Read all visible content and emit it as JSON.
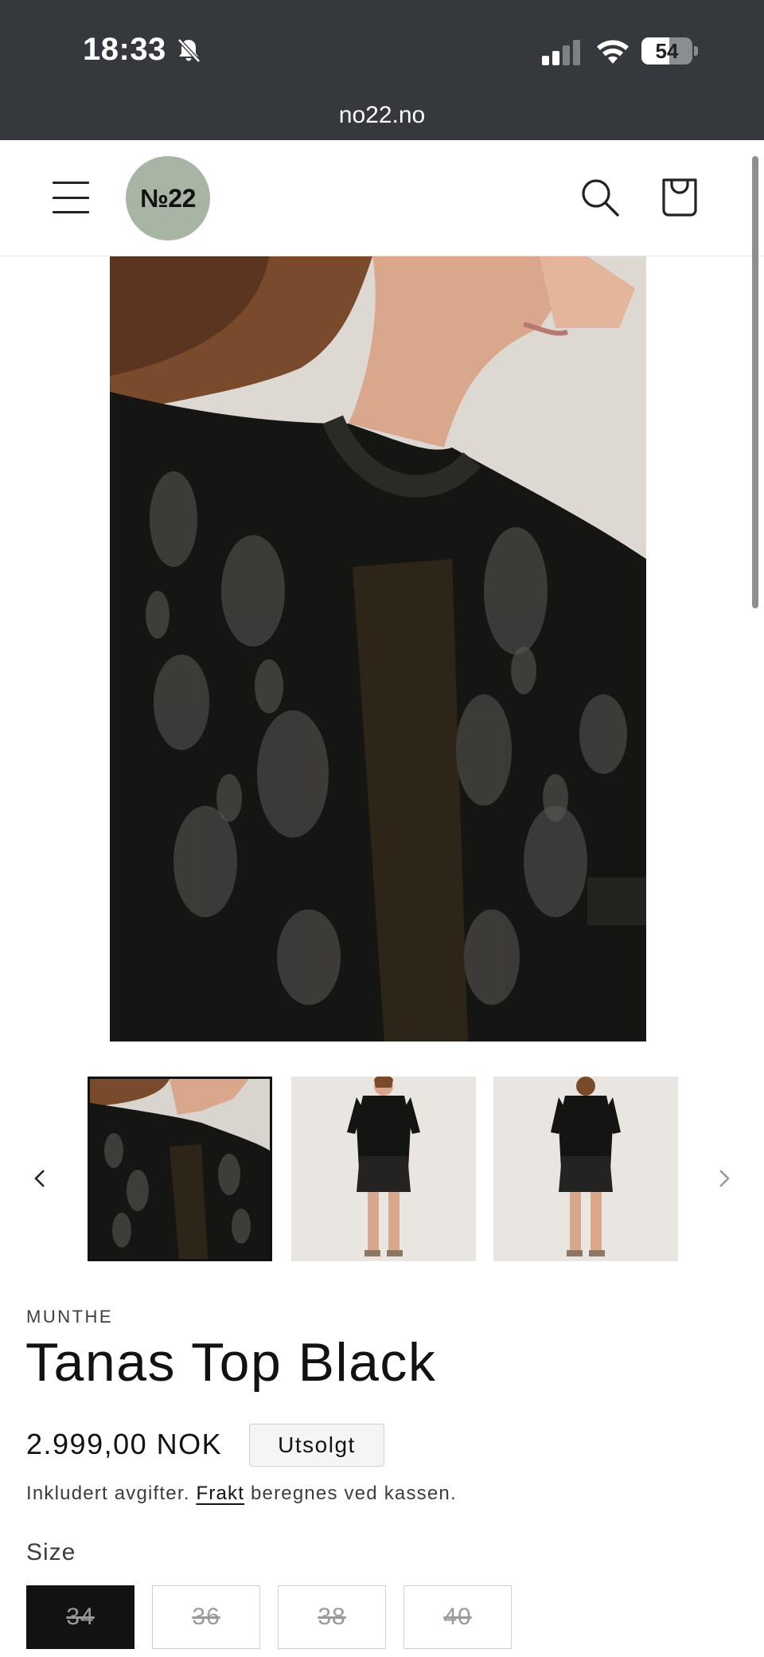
{
  "status_bar": {
    "time": "18:33",
    "battery_level": "54",
    "battery_fraction": 0.54
  },
  "browser": {
    "url": "no22.no"
  },
  "header": {
    "logo_text": "№22",
    "logo_color": "#a8b5a4",
    "icons": [
      "hamburger-menu-icon",
      "search-icon",
      "cart-icon"
    ]
  },
  "gallery": {
    "thumbnail_count": 3,
    "selected_index": 0
  },
  "product": {
    "vendor": "MUNTHE",
    "title": "Tanas Top Black",
    "price": "2.999,00 NOK",
    "badge": "Utsolgt",
    "tax_prefix": "Inkludert avgifter.",
    "tax_link": "Frakt",
    "tax_suffix": "beregnes ved kassen.",
    "size_label": "Size",
    "sizes": [
      "34",
      "36",
      "38",
      "40"
    ],
    "selected_size": "34"
  }
}
